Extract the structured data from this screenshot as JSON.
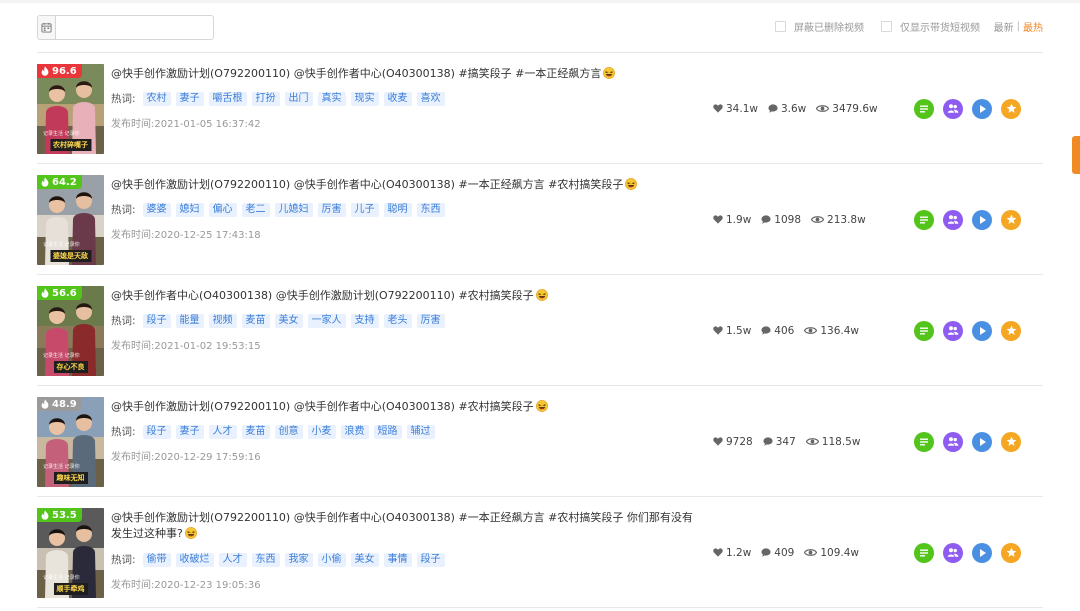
{
  "toolbar": {
    "date_value": "",
    "filter_deleted_label": "屏蔽已删除视频",
    "filter_goods_label": "仅显示带货短视频",
    "sort_newest": "最新",
    "sort_separator": "|",
    "sort_hottest": "最热"
  },
  "keyword_label": "热词:",
  "time_label": "发布时间:",
  "videos": [
    {
      "score": "96.6",
      "score_color": "#e8363a",
      "caption": "农村碎嘴子",
      "sub_caption": "记录生活 记录你",
      "title": "@快手创作激励计划(O792200110) @快手创作者中心(O40300138) #搞笑段子 #一本正经飙方言",
      "tags": [
        "农村",
        "妻子",
        "嚼舌根",
        "打扮",
        "出门",
        "真实",
        "现实",
        "收麦",
        "喜欢"
      ],
      "time": "2021-01-05 16:37:42",
      "likes": "34.1w",
      "comments": "3.6w",
      "views": "3479.6w"
    },
    {
      "score": "64.2",
      "score_color": "#52c41a",
      "caption": "婆媳是天敌",
      "sub_caption": "记录生活 记录你",
      "title": "@快手创作激励计划(O792200110) @快手创作者中心(O40300138) #一本正经飙方言 #农村搞笑段子",
      "tags": [
        "婆婆",
        "媳妇",
        "偏心",
        "老二",
        "儿媳妇",
        "厉害",
        "儿子",
        "聪明",
        "东西"
      ],
      "time": "2020-12-25 17:43:18",
      "likes": "1.9w",
      "comments": "1098",
      "views": "213.8w"
    },
    {
      "score": "56.6",
      "score_color": "#52c41a",
      "caption": "存心不良",
      "sub_caption": "记录生活 记录你",
      "title": "@快手创作者中心(O40300138) @快手创作激励计划(O792200110) #农村搞笑段子",
      "tags": [
        "段子",
        "能量",
        "视频",
        "麦苗",
        "美女",
        "一家人",
        "支持",
        "老头",
        "厉害"
      ],
      "time": "2021-01-02 19:53:15",
      "likes": "1.5w",
      "comments": "406",
      "views": "136.4w"
    },
    {
      "score": "48.9",
      "score_color": "#9a9a9a",
      "caption": "趣味无知",
      "sub_caption": "记录生活 记录你",
      "title": "@快手创作激励计划(O792200110) @快手创作者中心(O40300138) #农村搞笑段子",
      "tags": [
        "段子",
        "妻子",
        "人才",
        "麦苗",
        "创意",
        "小麦",
        "浪费",
        "短路",
        "辅过"
      ],
      "time": "2020-12-29 17:59:16",
      "likes": "9728",
      "comments": "347",
      "views": "118.5w"
    },
    {
      "score": "53.5",
      "score_color": "#52c41a",
      "caption": "顺手牵鸡",
      "sub_caption": "记录生活 记录你",
      "title": "@快手创作激励计划(O792200110) @快手创作者中心(O40300138) #一本正经飙方言 #农村搞笑段子 你们那有没有发生过这种事?",
      "tags": [
        "偷带",
        "收破烂",
        "人才",
        "东西",
        "我家",
        "小偷",
        "美女",
        "事情",
        "段子"
      ],
      "time": "2020-12-23 19:05:36",
      "likes": "1.2w",
      "comments": "409",
      "views": "109.4w"
    }
  ],
  "colors": {
    "accent_orange": "#f08a24",
    "tag_bg": "#e8f1fd",
    "tag_text": "#3b7dd8",
    "action_green": "#52c41a",
    "action_purple": "#8e5cf0",
    "action_blue": "#4a90e2",
    "action_orange": "#f5a623"
  },
  "icons": {
    "date_picker": "calendar-icon",
    "likes": "heart-icon",
    "comments": "comment-bubble-icon",
    "views": "eye-icon",
    "actions": [
      "detail-list-icon",
      "fans-icon",
      "play-icon",
      "favorite-star-icon"
    ],
    "title_emoji": "laughing-face-icon"
  }
}
